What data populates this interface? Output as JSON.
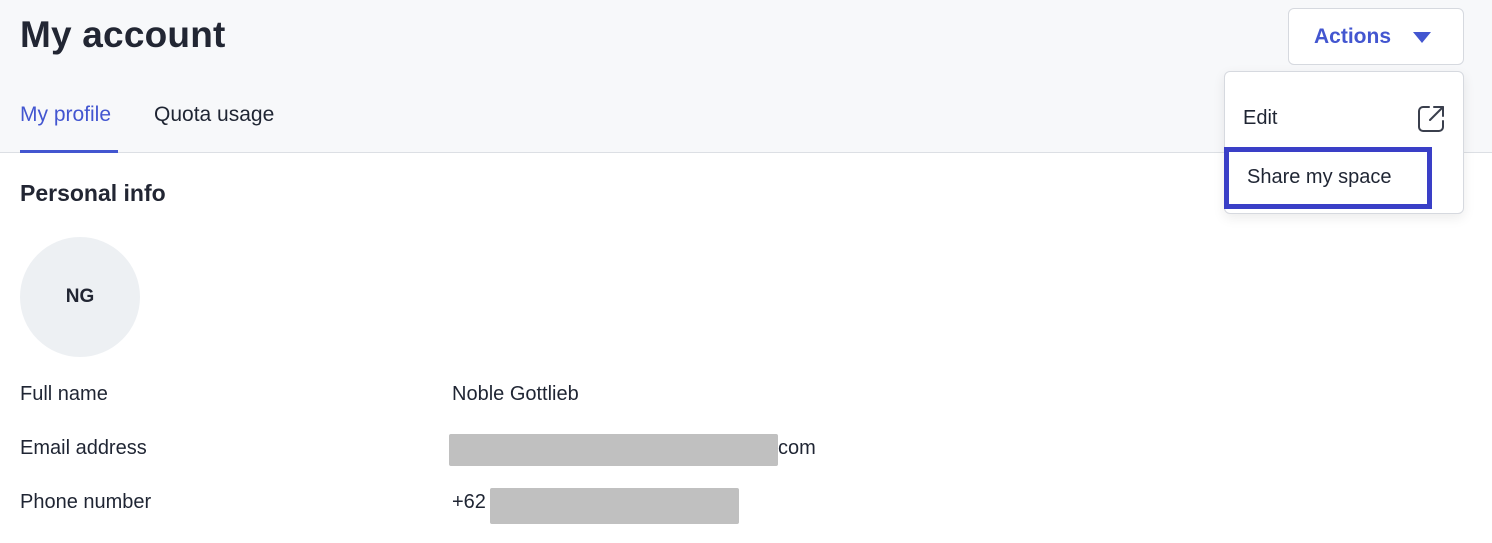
{
  "page": {
    "title": "My account"
  },
  "actions": {
    "label": "Actions",
    "caret_icon": "caret-down-icon",
    "menu": {
      "edit_label": "Edit",
      "edit_icon": "external-link-icon",
      "share_label": "Share my space"
    }
  },
  "tabs": [
    {
      "label": "My profile",
      "active": true
    },
    {
      "label": "Quota usage",
      "active": false
    }
  ],
  "personal_info": {
    "section_title": "Personal info",
    "avatar_initials": "NG",
    "rows": [
      {
        "label": "Full name",
        "value": "Noble Gottlieb"
      },
      {
        "label": "Email address",
        "value_suffix": "com"
      },
      {
        "label": "Phone number",
        "value_prefix": "+62"
      }
    ]
  },
  "colors": {
    "accent": "#4356d0",
    "highlight_border": "#3a3fc7",
    "header_bg": "#f7f8fa",
    "redaction": "#c0c0c0"
  }
}
